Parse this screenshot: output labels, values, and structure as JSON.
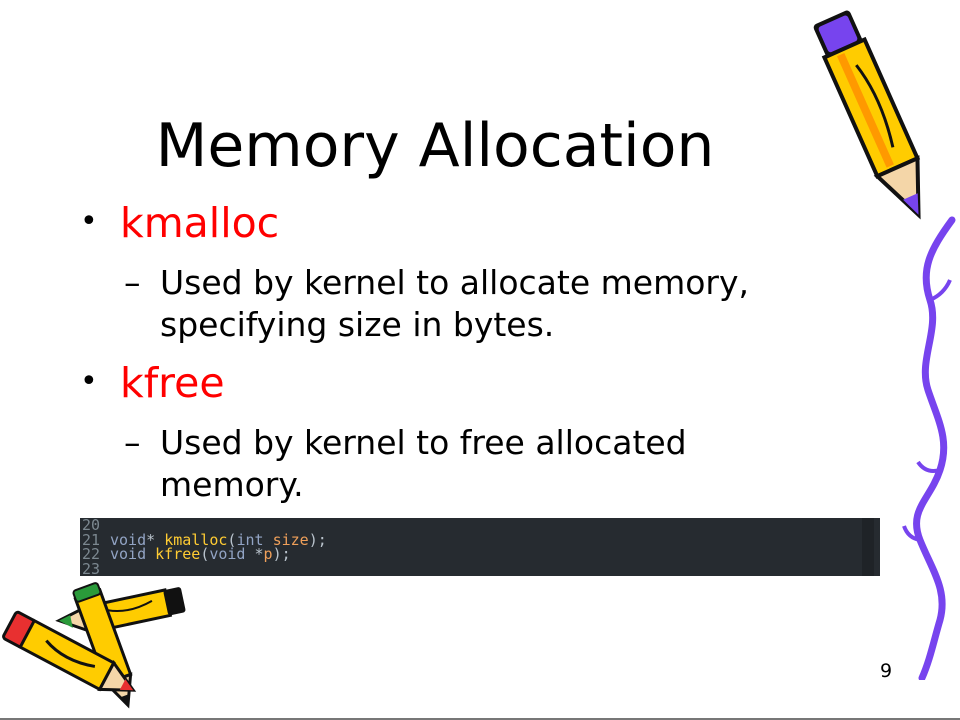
{
  "slide": {
    "title": "Memory Allocation",
    "bullets": [
      {
        "label": "kmalloc",
        "sub": "Used by kernel to allocate memory, specifying size in bytes."
      },
      {
        "label": "kfree",
        "sub": "Used by kernel to free allocated memory."
      }
    ],
    "bullet_marker": "•",
    "sub_marker": "–",
    "page_number": "9"
  },
  "code": {
    "lines": [
      {
        "num": "20",
        "tokens": []
      },
      {
        "num": "21",
        "tokens": [
          {
            "t": "void",
            "c": "kw"
          },
          {
            "t": "* ",
            "c": "pu"
          },
          {
            "t": "kmalloc",
            "c": "fn"
          },
          {
            "t": "(",
            "c": "pu"
          },
          {
            "t": "int",
            "c": "kw"
          },
          {
            "t": " ",
            "c": "pu"
          },
          {
            "t": "size",
            "c": "pm"
          },
          {
            "t": ");",
            "c": "pu"
          }
        ]
      },
      {
        "num": "22",
        "tokens": [
          {
            "t": "void",
            "c": "kw"
          },
          {
            "t": " ",
            "c": "pu"
          },
          {
            "t": "kfree",
            "c": "fn"
          },
          {
            "t": "(",
            "c": "pu"
          },
          {
            "t": "void",
            "c": "kw"
          },
          {
            "t": " *",
            "c": "pu"
          },
          {
            "t": "p",
            "c": "pm"
          },
          {
            "t": ");",
            "c": "pu"
          }
        ]
      },
      {
        "num": "23",
        "tokens": []
      }
    ]
  },
  "colors": {
    "bullet_label": "#ff0000",
    "code_bg": "#262b30",
    "vine": "#7744ee",
    "pencil_body": "#ffcc00"
  },
  "icons": [
    "pencil-clipart-icon",
    "vine-decoration-icon",
    "crossed-pencils-clipart-icon"
  ]
}
